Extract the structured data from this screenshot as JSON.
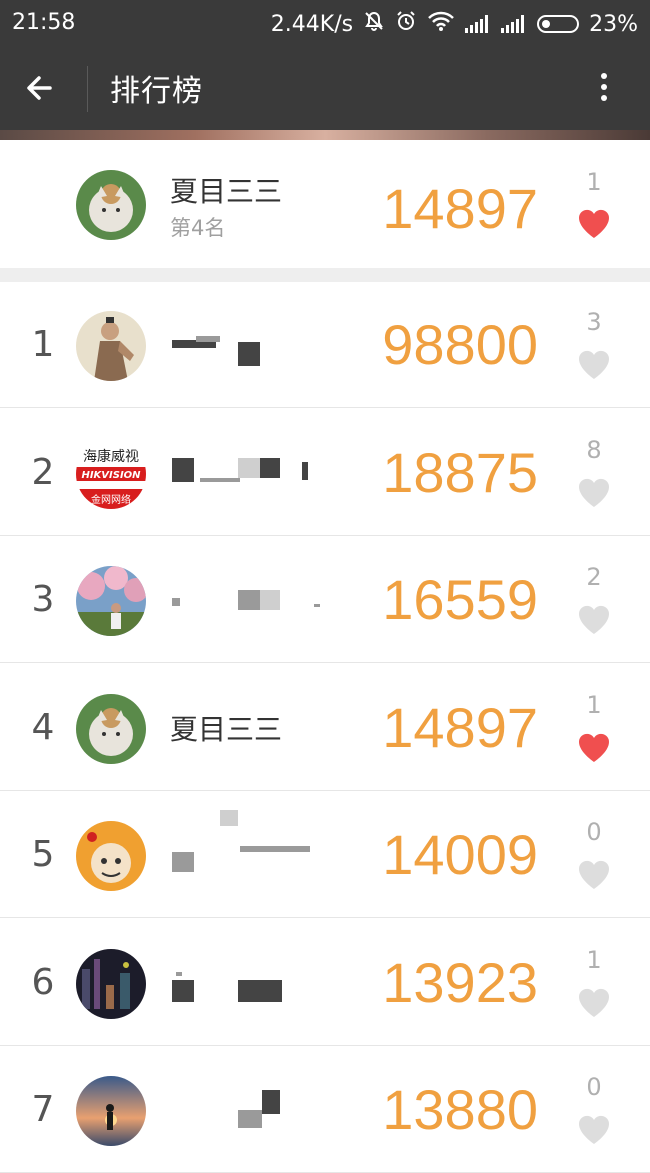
{
  "status_bar": {
    "time": "21:58",
    "net_speed": "2.44K/s",
    "battery_percent": "23%",
    "battery_level": 0.23
  },
  "toolbar": {
    "title": "排行榜",
    "back_icon": "arrow-left-icon",
    "menu_icon": "more-vertical-icon"
  },
  "my_rank": {
    "name": "夏目三三",
    "position": "第4名",
    "score": "14897",
    "likes": "1",
    "liked": true
  },
  "colors": {
    "score": "#f0a040",
    "heart_liked": "#f04f4f",
    "heart_unliked": "#dddddd",
    "bar": "#3a3a3a"
  },
  "rows": [
    {
      "rank": "1",
      "name": "",
      "score": "98800",
      "likes": "3",
      "liked": false
    },
    {
      "rank": "2",
      "name": "",
      "score": "18875",
      "likes": "8",
      "liked": false
    },
    {
      "rank": "3",
      "name": "",
      "score": "16559",
      "likes": "2",
      "liked": false
    },
    {
      "rank": "4",
      "name": "夏目三三",
      "score": "14897",
      "likes": "1",
      "liked": true
    },
    {
      "rank": "5",
      "name": "",
      "score": "14009",
      "likes": "0",
      "liked": false
    },
    {
      "rank": "6",
      "name": "",
      "score": "13923",
      "likes": "1",
      "liked": false
    },
    {
      "rank": "7",
      "name": "",
      "score": "13880",
      "likes": "0",
      "liked": false
    }
  ],
  "avatar_badge_text": {
    "hikvision_cn": "海康威视",
    "hikvision_en": "HIKVISION",
    "hikvision_sub": "金网网络"
  }
}
